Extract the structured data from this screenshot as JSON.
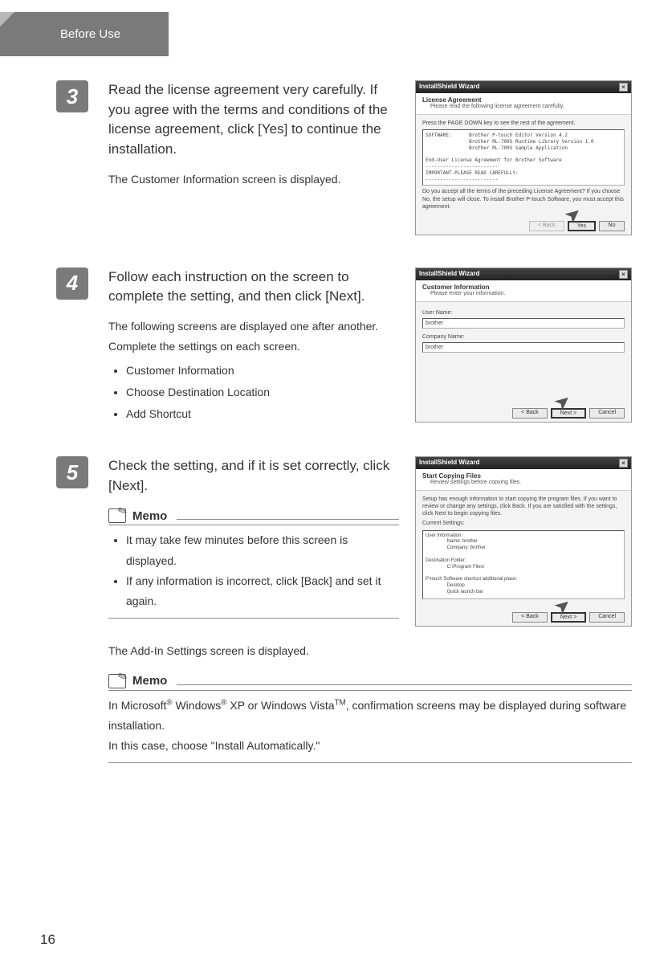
{
  "header": {
    "title": "Before Use"
  },
  "page_number": "16",
  "steps": {
    "s3": {
      "num": "3",
      "desc": "Read the license agreement very carefully. If you agree with the terms and conditions of the license agreement, click [Yes] to continue the installation.",
      "sub": "The Customer Information screen is displayed.",
      "dialog": {
        "title": "InstallShield Wizard",
        "h1": "License Agreement",
        "h2": "Please read the following license agreement carefully.",
        "hint": "Press the PAGE DOWN key to see the rest of the agreement.",
        "box": "SOFTWARE:      Brother P-touch Editor Version 4.2\n               Brother RL-700S Runtime Library Version 1.0\n               Brother RL-700S Sample Application\n\nEnd-User License Agreement for Brother Software\n-------------------------\nIMPORTANT-PLEASE READ CAREFULLY:\n-------------------------",
        "confirm": "Do you accept all the terms of the preceding License Agreement? If you choose No, the setup will close. To install Brother P-touch Software, you must accept this agreement.",
        "btn_back": "< Back",
        "btn_yes": "Yes",
        "btn_no": "No"
      }
    },
    "s4": {
      "num": "4",
      "desc": "Follow each instruction on the screen to complete the setting, and then click [Next].",
      "sub": "The following screens are displayed one after another. Complete the settings on each screen.",
      "list": [
        "Customer Information",
        "Choose Destination Location",
        "Add Shortcut"
      ],
      "dialog": {
        "title": "InstallShield Wizard",
        "h1": "Customer Information",
        "h2": "Please enter your information.",
        "lbl_user": "User Name:",
        "val_user": "brother",
        "lbl_comp": "Company Name:",
        "val_comp": "brother",
        "btn_back": "< Back",
        "btn_next": "Next >",
        "btn_cancel": "Cancel"
      }
    },
    "s5": {
      "num": "5",
      "desc": "Check the setting, and if it is set correctly, click [Next].",
      "memo": {
        "title": "Memo",
        "items": [
          "It may take few minutes before this screen is displayed.",
          "If any information is incorrect, click [Back] and set it again."
        ]
      },
      "dialog": {
        "title": "InstallShield Wizard",
        "h1": "Start Copying Files",
        "h2": "Review settings before copying files.",
        "hint": "Setup has enough information to start copying the program files. If you want to review or change any settings, click Back. If you are satisfied with the settings, click Next to begin copying files.",
        "cur": "Current Settings:",
        "box": "User Information:\n                Name: brother\n                Company: brother\n\nDestination Folder:\n                C:\\Program Files\\\n\nP-touch Software shortcut additional place:\n                Desktop\n                Quick launch bar",
        "btn_back": "< Back",
        "btn_next": "Next >",
        "btn_cancel": "Cancel"
      },
      "after": "The Add-In Settings screen is displayed."
    }
  },
  "memo2": {
    "title": "Memo",
    "t1a": "In Microsoft",
    "t1b": " Windows",
    "t1c": " XP or Windows Vista",
    "t1d": ", confirmation screens may be displayed during software installation.",
    "reg": "®",
    "tm": "TM",
    "t2": "In this case, choose \"Install Automatically.\""
  }
}
